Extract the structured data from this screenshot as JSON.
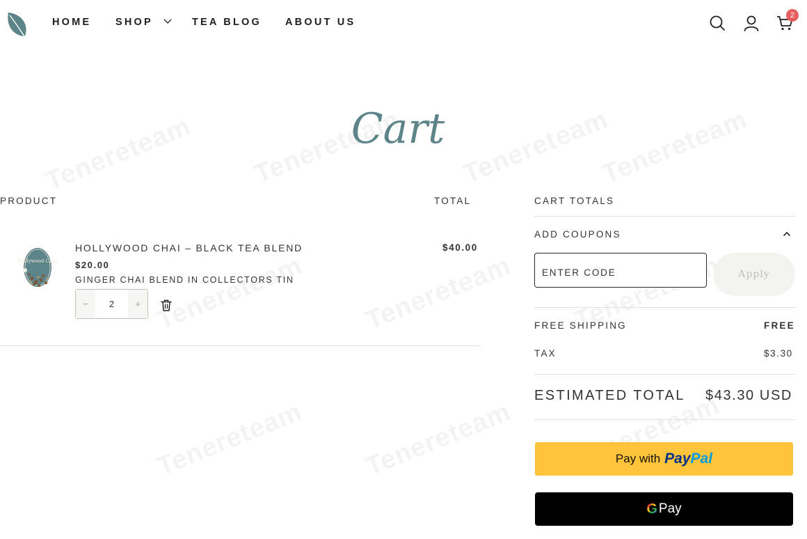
{
  "watermark": "Tenereteam",
  "nav": {
    "home": "HOME",
    "shop": "SHOP",
    "blog": "TEA BLOG",
    "about": "ABOUT US",
    "cart_count": "2"
  },
  "page_title": "Cart",
  "table": {
    "product_header": "PRODUCT",
    "total_header": "TOTAL"
  },
  "item": {
    "thumb_label": "Hollywood Chai",
    "name": "HOLLYWOOD CHAI – BLACK TEA BLEND",
    "price": "$20.00",
    "variant": "GINGER CHAI BLEND IN COLLECTORS TIN",
    "quantity": "2",
    "minus": "−",
    "plus": "+",
    "line_total": "$40.00"
  },
  "totals": {
    "heading": "CART TOTALS",
    "coupons_label": "ADD COUPONS",
    "coupon_placeholder": "ENTER CODE",
    "apply_label": "Apply",
    "shipping_label": "FREE SHIPPING",
    "shipping_value": "FREE",
    "tax_label": "TAX",
    "tax_value": "$3.30",
    "estimated_label": "ESTIMATED TOTAL",
    "estimated_value": "$43.30 USD"
  },
  "payments": {
    "paypal_prefix": "Pay with",
    "paypal_brand_1": "Pay",
    "paypal_brand_2": "Pal",
    "gpay_g": "G",
    "gpay_label": "Pay"
  },
  "colors": {
    "accent_teal": "#5d8589",
    "paypal_yellow": "#ffc439",
    "badge_red": "#e85d5d"
  }
}
